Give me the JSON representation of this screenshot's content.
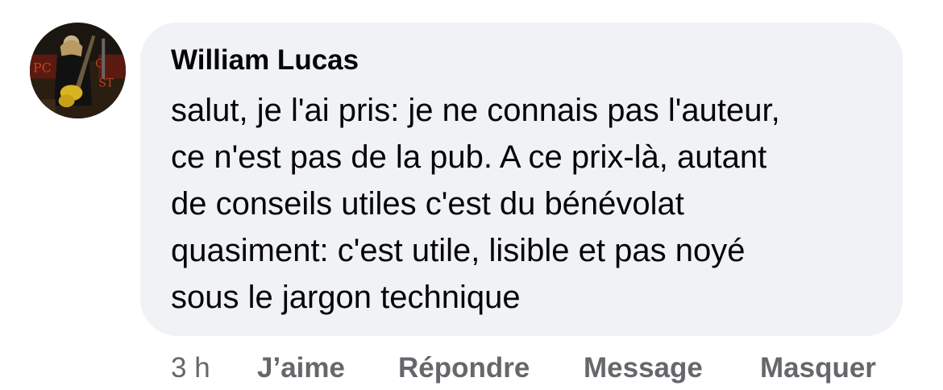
{
  "comment": {
    "author": "William Lucas",
    "text_lines": [
      "salut, je l'ai pris: je ne connais pas l'auteur,",
      "ce n'est pas de la pub. A ce prix-là, autant",
      "de conseils utiles c'est du bénévolat",
      "quasiment: c'est utile, lisible et pas noyé",
      "sous le jargon technique"
    ],
    "timestamp": "3 h",
    "actions": {
      "like": "J’aime",
      "reply": "Répondre",
      "message": "Message",
      "hide": "Masquer"
    },
    "avatar_icon": "user-avatar-photo"
  },
  "colors": {
    "bubble_background": "#f0f2f5",
    "text": "#050505",
    "secondary_text": "#65676b"
  }
}
